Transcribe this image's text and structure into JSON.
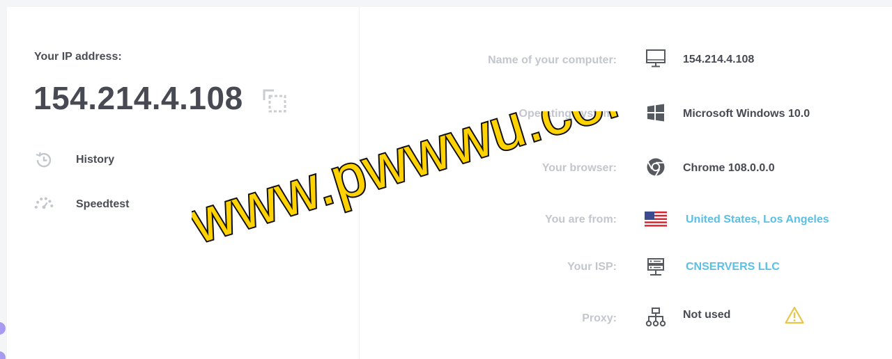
{
  "ip_section": {
    "label": "Your IP address:",
    "value": "154.214.4.108"
  },
  "side_links": [
    {
      "label": "History",
      "icon": "history-icon"
    },
    {
      "label": "Speedtest",
      "icon": "speedometer-icon"
    }
  ],
  "info_rows": [
    {
      "label": "Name of your computer:",
      "value": "154.214.4.108",
      "icon": "monitor-icon",
      "link": false
    },
    {
      "label": "Operating system:",
      "value": "Microsoft Windows 10.0",
      "icon": "windows-logo-icon",
      "link": false
    },
    {
      "label": "Your browser:",
      "value": "Chrome 108.0.0.0",
      "icon": "chrome-logo-icon",
      "link": false
    },
    {
      "label": "You are from:",
      "value": "United States, Los Angeles",
      "icon": "us-flag-icon",
      "link": true
    },
    {
      "label": "Your ISP:",
      "value": "CNSERVERS LLC",
      "icon": "server-icon",
      "link": true
    },
    {
      "label": "Proxy:",
      "value": "Not used",
      "icon": "network-icon",
      "link": false
    }
  ],
  "proxy_warning_icon": "warning-icon",
  "watermark": {
    "text": "www.pwwwu.com",
    "color": "#ffd200",
    "outline": "#111111"
  },
  "colors": {
    "link": "#5bbfe6",
    "label_muted": "#c3c6cc",
    "text_dark": "#474a52",
    "warning": "#e8c547"
  }
}
